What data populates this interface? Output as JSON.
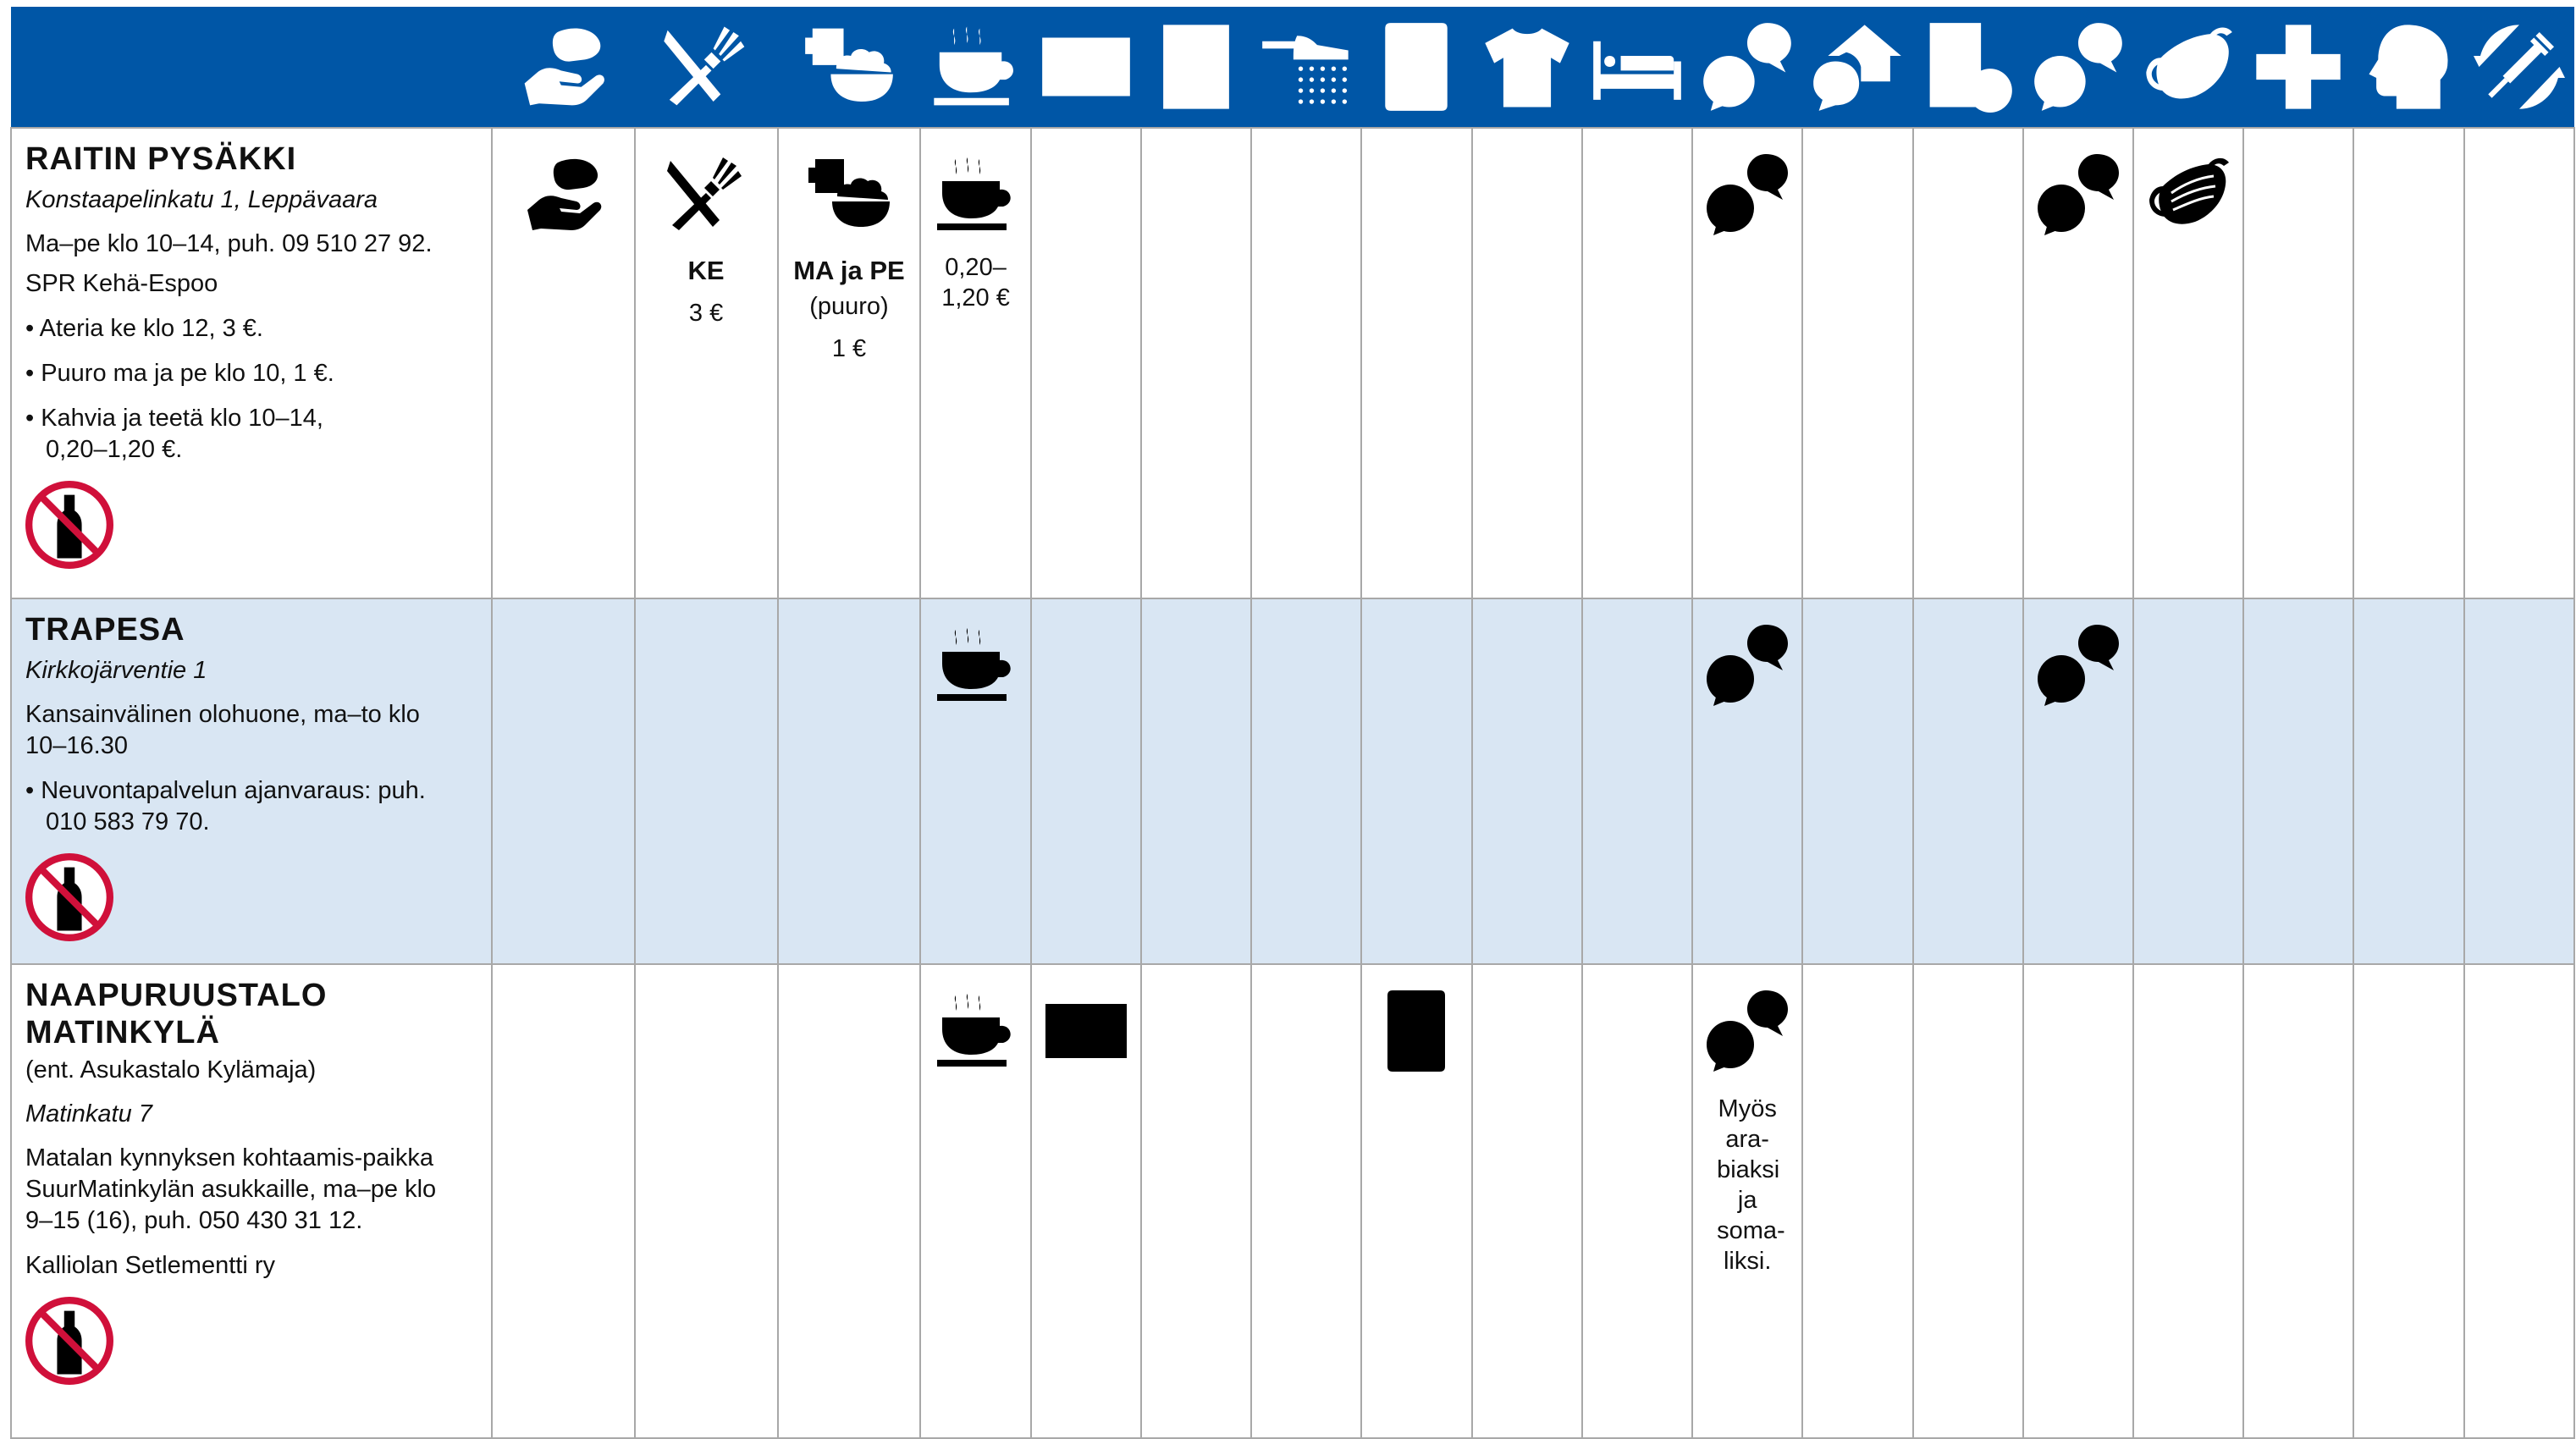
{
  "colors": {
    "header_blue": "#0056a6",
    "row_tint": "#d9e6f3",
    "no_alcohol_red": "#d0103a"
  },
  "header_icons": [
    "bread-hand-icon",
    "cutlery-icon",
    "porridge-icon",
    "coffee-icon",
    "microwave-icon",
    "washing-machine-icon",
    "shower-icon",
    "phone-wifi-icon",
    "tshirt-icon",
    "bed-icon",
    "advice-question-icon",
    "housing-advice-icon",
    "finance-advice-icon",
    "chat-icon",
    "face-mask-icon",
    "health-cross-icon",
    "mental-health-icon",
    "vaccination-icon"
  ],
  "rows": [
    {
      "name": "RAITIN PYSÄKKI",
      "address": "Konstaapelinkatu 1, Leppävaara",
      "hours": "Ma–pe klo 10–14, puh. 09 510 27 92.",
      "org": "SPR Kehä-Espoo",
      "bullets": [
        "• Ateria ke klo 12, 3 €.",
        "• Puuro ma ja pe klo 10, 1 €.",
        "• Kahvia ja teetä klo 10–14, 0,20–1,20 €."
      ],
      "meal_day": "KE",
      "meal_price": "3 €",
      "porridge_days": "MA ja PE",
      "porridge_note": "(puuro)",
      "porridge_price": "1 €",
      "coffee_price": "0,20–1,20 €"
    },
    {
      "name": "TRAPESA",
      "address": "Kirkkojärventie 1",
      "desc": "Kansainvälinen olohuone, ma–to klo 10–16.30",
      "bullets": [
        "• Neuvontapalvelun ajanvaraus: puh. 010 583 79 70."
      ]
    },
    {
      "name": "NAAPURUUSTALO MATINKYLÄ",
      "former": "(ent. Asukastalo Kylämaja)",
      "address": "Matinkatu 7",
      "desc": "Matalan kynnyksen kohtaamis-paikka SuurMatinkylän asukkaille, ma–pe klo 9–15 (16), puh. 050 430 31 12.",
      "org": "Kalliolan Setlementti ry",
      "advice_note": "Myös ara-biaksi ja soma-liksi."
    }
  ]
}
